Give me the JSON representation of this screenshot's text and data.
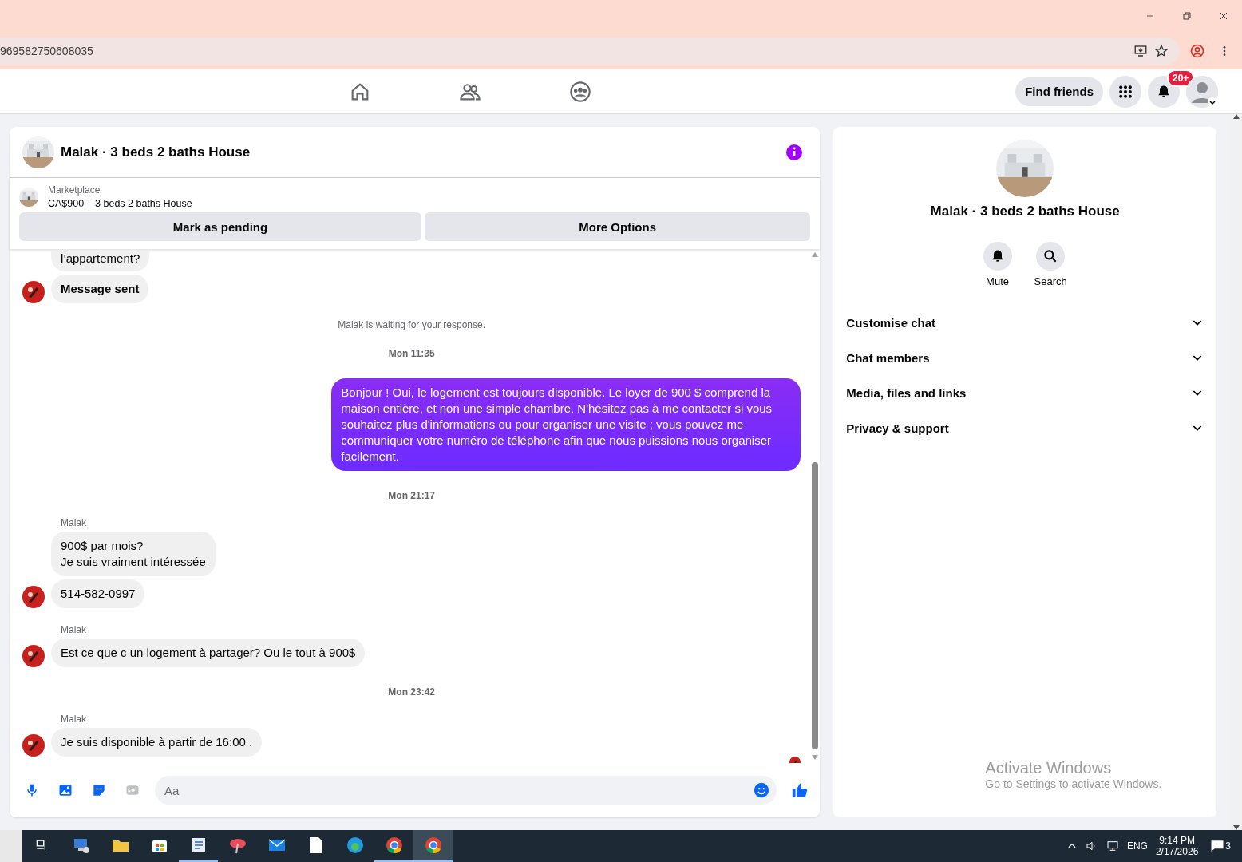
{
  "browser": {
    "url": "969582750608035"
  },
  "top_actions": {
    "find_friends": "Find friends",
    "notification_badge": "20+"
  },
  "chat": {
    "title": "Malak · 3 beds 2 baths House",
    "listing": {
      "source": "Marketplace",
      "title": "CA$900 – 3 beds 2 baths House"
    },
    "actions": [
      "Mark as pending",
      "More Options"
    ],
    "messages": [
      {
        "kind": "received",
        "text": "l’appartement?",
        "avatar": false,
        "bold": false
      },
      {
        "kind": "received",
        "text": "Message sent",
        "avatar": true,
        "bold": true
      },
      {
        "kind": "system",
        "text": "Malak is waiting for your response."
      },
      {
        "kind": "timestamp",
        "text": "Mon 11:35"
      },
      {
        "kind": "sent",
        "text": "Bonjour ! Oui, le logement est toujours disponible. Le loyer de 900 $ comprend la maison entière, et non une simple chambre. N'hésitez pas à me contacter si vous souhaitez plus d'informations ou pour organiser une visite ; vous pouvez me communiquer votre numéro de téléphone afin que nous puissions nous organiser facilement."
      },
      {
        "kind": "timestamp",
        "text": "Mon 21:17"
      },
      {
        "kind": "sender",
        "text": "Malak"
      },
      {
        "kind": "received",
        "text": "900$ par mois?\nJe suis vraiment intéressée",
        "avatar": false,
        "bold": false
      },
      {
        "kind": "received",
        "text": "514-582-0997",
        "avatar": true,
        "bold": false
      },
      {
        "kind": "sender",
        "text": "Malak"
      },
      {
        "kind": "received",
        "text": "Est ce que c un logement à partager? Ou le tout à 900$",
        "avatar": true,
        "bold": false
      },
      {
        "kind": "timestamp",
        "text": "Mon 23:42"
      },
      {
        "kind": "sender",
        "text": "Malak"
      },
      {
        "kind": "received",
        "text": "Je suis disponible à partir de 16:00 .",
        "avatar": true,
        "bold": false
      }
    ],
    "composer": {
      "placeholder": "Aa"
    }
  },
  "details": {
    "title": "Malak · 3 beds 2 baths House",
    "actions": [
      {
        "kind": "bell",
        "label": "Mute"
      },
      {
        "kind": "search",
        "label": "Search"
      }
    ],
    "sections": [
      {
        "label": "Customise chat",
        "expanded": false
      },
      {
        "label": "Chat members",
        "expanded": false
      },
      {
        "label": "Media, files and links",
        "expanded": false
      },
      {
        "label": "Privacy & support",
        "expanded": false
      }
    ]
  },
  "windows_notice": {
    "title": "Activate Windows",
    "subtitle": "Go to Settings to activate Windows."
  },
  "taskbar": {
    "apps": [
      {
        "kind": "taskview",
        "open": false,
        "selected": false
      },
      {
        "kind": "computer",
        "open": false,
        "selected": false
      },
      {
        "kind": "folder",
        "open": false,
        "selected": false
      },
      {
        "kind": "store",
        "open": false,
        "selected": false
      },
      {
        "kind": "document",
        "open": true,
        "selected": false
      },
      {
        "kind": "pinwheel",
        "open": false,
        "selected": false
      },
      {
        "kind": "mail",
        "open": false,
        "selected": false
      },
      {
        "kind": "file",
        "open": false,
        "selected": false
      },
      {
        "kind": "edge",
        "open": false,
        "selected": false
      },
      {
        "kind": "chrome",
        "open": true,
        "selected": false
      },
      {
        "kind": "chrome",
        "open": true,
        "selected": true
      }
    ],
    "language": "ENG",
    "time": "9:14 PM",
    "date": "2/17/2026",
    "notifications": "3"
  }
}
